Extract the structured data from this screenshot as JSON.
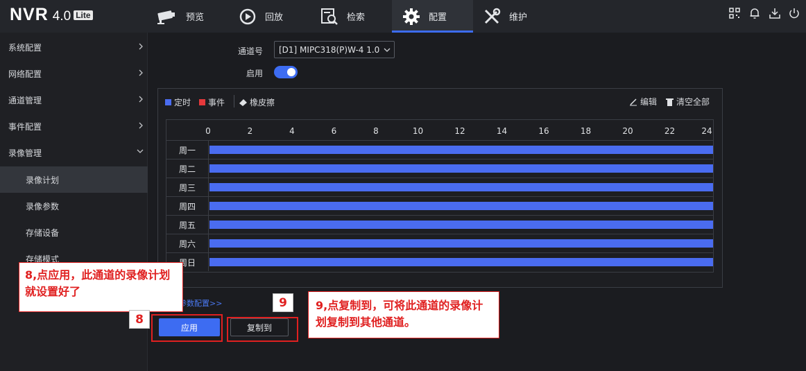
{
  "logo": {
    "brand": "NVR",
    "version": "4.0",
    "edition": "Lite"
  },
  "nav": [
    {
      "label": "预览",
      "icon": "camera-icon"
    },
    {
      "label": "回放",
      "icon": "playback-icon"
    },
    {
      "label": "检索",
      "icon": "search-icon"
    },
    {
      "label": "配置",
      "icon": "gear-icon",
      "active": true
    },
    {
      "label": "维护",
      "icon": "tools-icon"
    }
  ],
  "top_icons": [
    "qr-code-icon",
    "bell-icon",
    "download-icon",
    "power-icon"
  ],
  "sidebar": {
    "items": [
      {
        "label": "系统配置"
      },
      {
        "label": "网络配置"
      },
      {
        "label": "通道管理"
      },
      {
        "label": "事件配置"
      },
      {
        "label": "录像管理"
      },
      {
        "label": "录像计划"
      },
      {
        "label": "录像参数"
      },
      {
        "label": "存储设备"
      },
      {
        "label": "存储模式"
      }
    ]
  },
  "form": {
    "channel_label": "通道号",
    "channel_value": "[D1] MIPC318(P)W-4 1.0",
    "enable_label": "启用",
    "enabled": true
  },
  "schedule": {
    "legend": [
      {
        "label": "定时",
        "color": "#4a6cf0"
      },
      {
        "label": "事件",
        "color": "#e5383b"
      }
    ],
    "eraser_label": "橡皮擦",
    "edit_label": "编辑",
    "clear_label": "清空全部",
    "hours": [
      "0",
      "2",
      "4",
      "6",
      "8",
      "10",
      "12",
      "14",
      "16",
      "18",
      "20",
      "22",
      "24"
    ],
    "days": [
      "周一",
      "周二",
      "周三",
      "周四",
      "周五",
      "周六",
      "周日"
    ],
    "bar_color": "#4a6cf0"
  },
  "advanced_link": "参数配置>>",
  "buttons": {
    "apply": "应用",
    "copy": "复制到"
  },
  "annotations": {
    "step8_num": "8",
    "step8_text": "8,点应用，此通道的录像计划就设置好了",
    "step9_num": "9",
    "step9_text": "9,点复制到，可将此通道的录像计划复制到其他通道。"
  }
}
